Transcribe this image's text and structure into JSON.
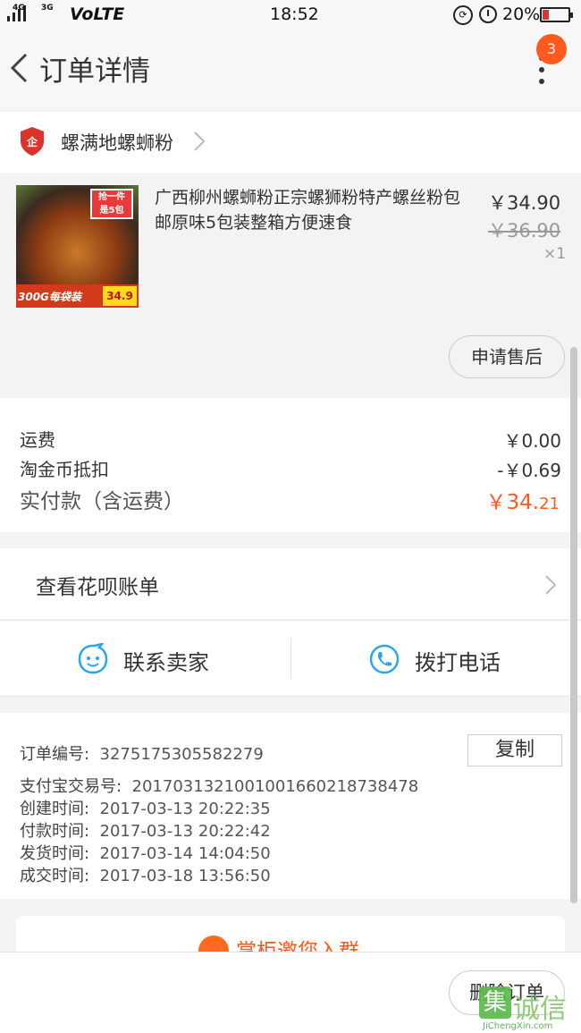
{
  "status_bar": {
    "net1": "4G",
    "net2": "3G",
    "volte": "VoLTE",
    "time": "18:52",
    "battery": "20%",
    "battery_color": "#e23232"
  },
  "header": {
    "title": "订单详情",
    "badge_count": "3",
    "accent": "#ff5a1e"
  },
  "shop": {
    "name": "螺满地螺蛳粉",
    "icon": "shop-shield-icon"
  },
  "product": {
    "image_tag": "抢一件\n是5包",
    "image_banner": "300G每袋装",
    "image_price": "34.9",
    "title": "广西柳州螺蛳粉正宗螺狮粉特产螺丝粉包邮原味5包装整箱方便速食",
    "price": "￥34.90",
    "original_price": "￥36.90",
    "quantity": "×1",
    "after_sale_label": "申请售后"
  },
  "costs": {
    "shipping_label": "运费",
    "shipping_value": "￥0.00",
    "coin_label": "淘金币抵扣",
    "coin_value": "-￥0.69",
    "paid_label": "实付款（含运费）",
    "paid_main": "￥34.",
    "paid_cents": "21"
  },
  "huabei": {
    "label": "查看花呗账单"
  },
  "contact": {
    "seller_label": "联系卖家",
    "call_label": "拨打电话"
  },
  "order_info": {
    "order_no_label": "订单编号:",
    "order_no": "3275175305582279",
    "copy_label": "复制",
    "alipay_label": "支付宝交易号:",
    "alipay_no": "2017031321001001660218738478",
    "created_label": "创建时间:",
    "created": "2017-03-13 20:22:35",
    "paid_label": "付款时间:",
    "paid": "2017-03-13 20:22:42",
    "shipped_label": "发货时间:",
    "shipped": "2017-03-14 14:04:50",
    "closed_label": "成交时间:",
    "closed": "2017-03-18 13:56:50"
  },
  "promo": {
    "text": "掌柜邀您入群"
  },
  "bottom": {
    "delete_label": "删除订单"
  },
  "watermark": {
    "brand": "诚信",
    "url": "JiChengXin.com"
  }
}
